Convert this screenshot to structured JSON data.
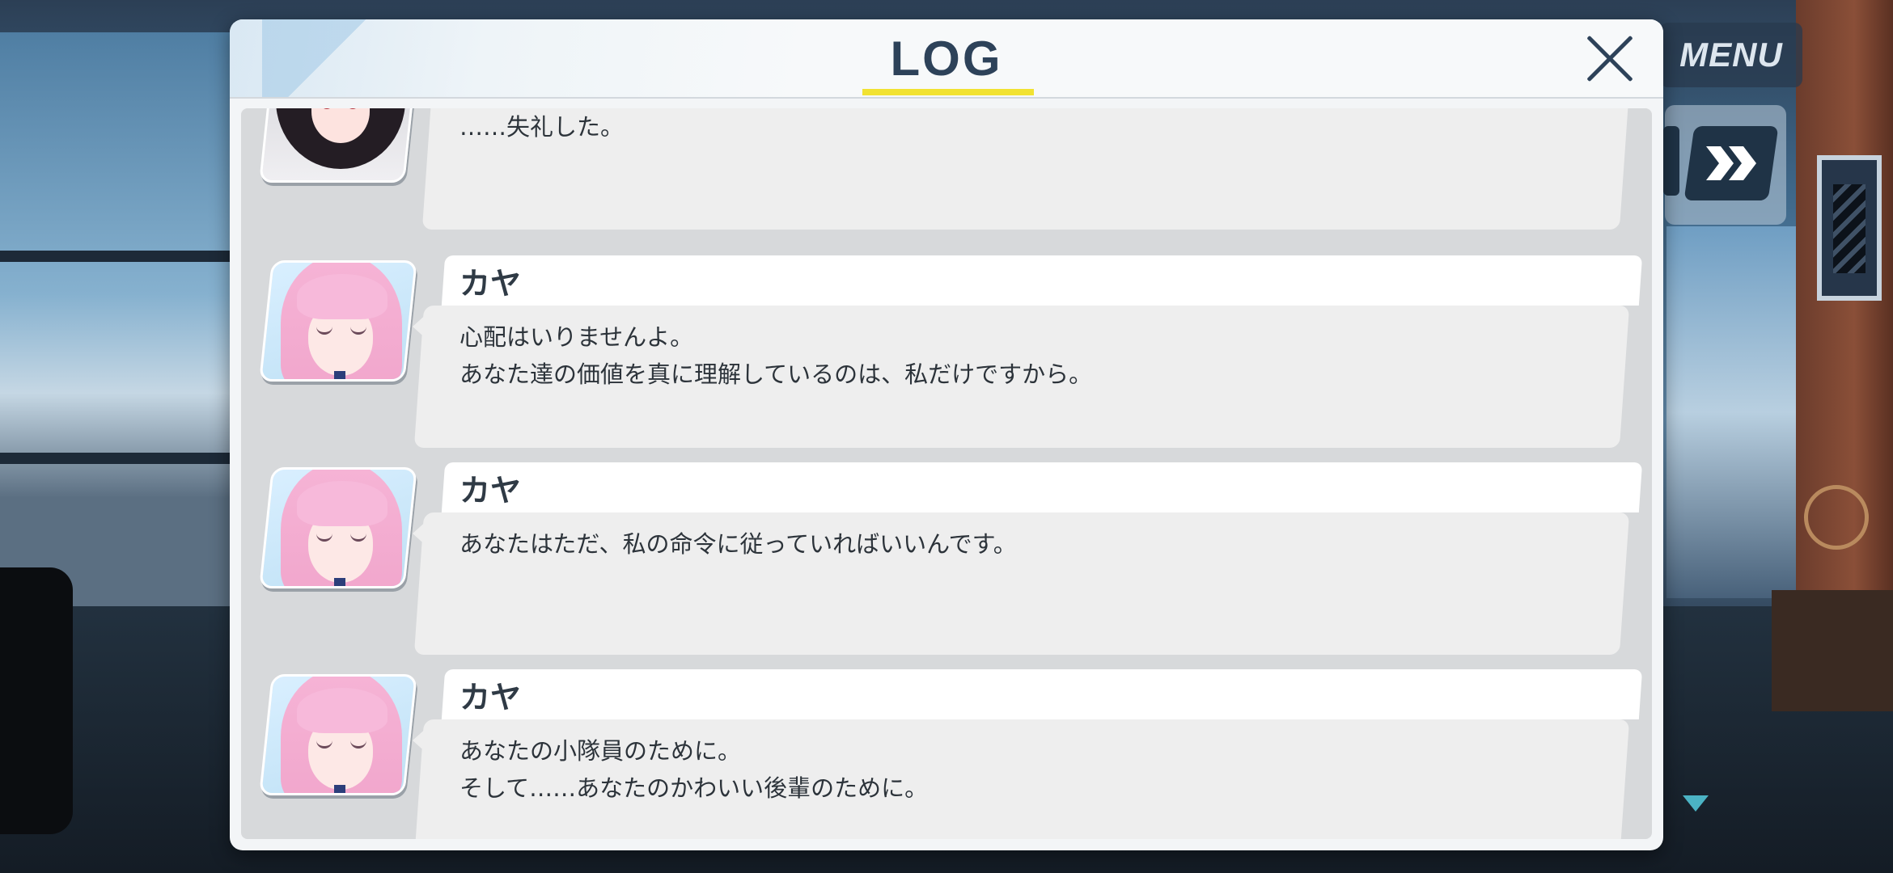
{
  "ui": {
    "menu_label": "MENU",
    "log_title": "LOG",
    "accent_color": "#f1e232",
    "title_color": "#2d4259",
    "icons": {
      "close": "close-icon",
      "fast_forward": "fast-forward-icon",
      "scroll_down": "scroll-down-icon"
    }
  },
  "log": {
    "entries": [
      {
        "speaker": "",
        "portrait": "dark-haired-student",
        "lines": [
          "……失礼した。"
        ]
      },
      {
        "speaker": "カヤ",
        "portrait": "kaya",
        "lines": [
          "心配はいりませんよ。",
          "あなた達の価値を真に理解しているのは、私だけですから。"
        ]
      },
      {
        "speaker": "カヤ",
        "portrait": "kaya",
        "lines": [
          "あなたはただ、私の命令に従っていればいいんです。"
        ]
      },
      {
        "speaker": "カヤ",
        "portrait": "kaya",
        "lines": [
          "あなたの小隊員のために。",
          "そして……あなたのかわいい後輩のために。"
        ]
      }
    ]
  }
}
